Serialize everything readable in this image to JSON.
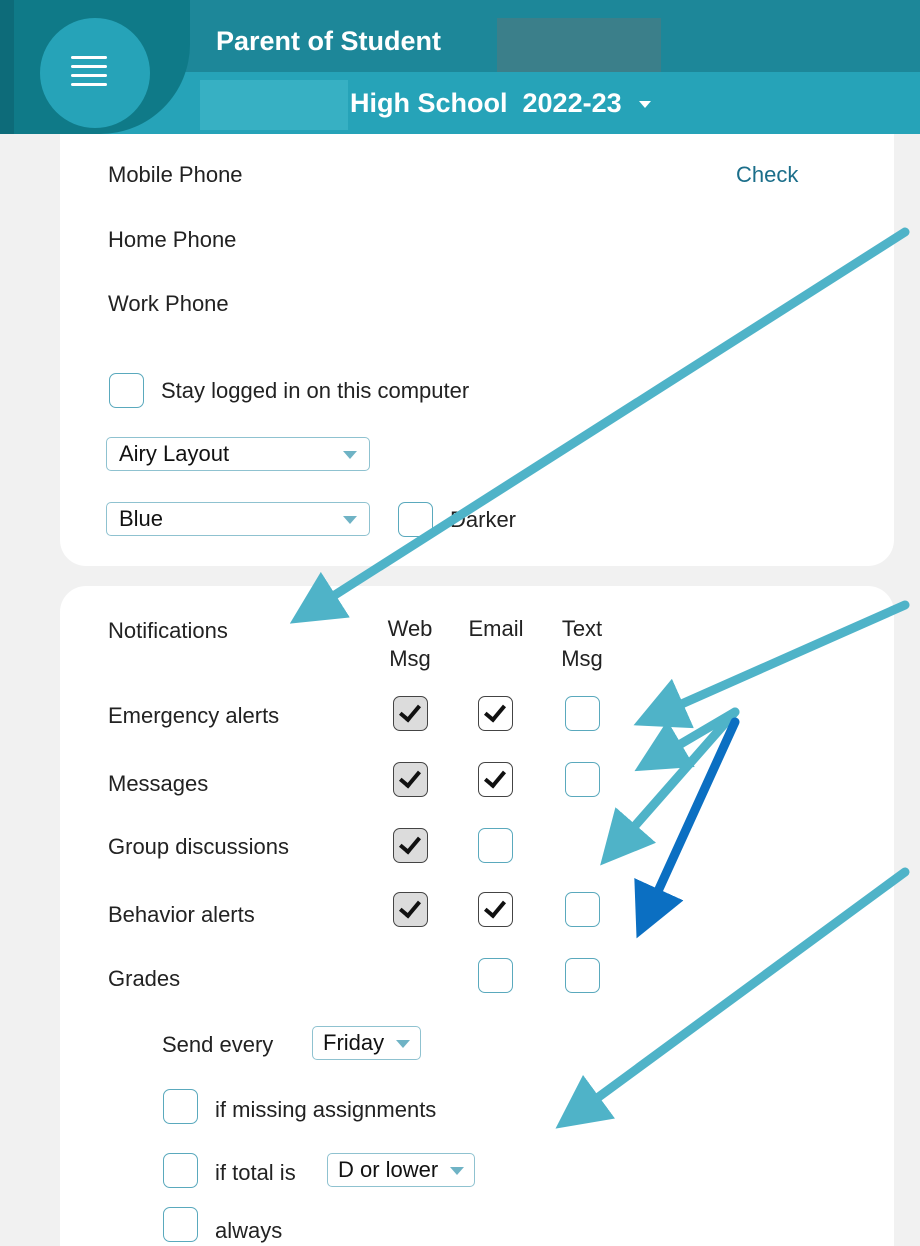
{
  "header": {
    "title": "Parent of Student",
    "school": "High School",
    "year": "2022-23"
  },
  "contact": {
    "mobile_label": "Mobile Phone",
    "check_label": "Check",
    "home_label": "Home Phone",
    "work_label": "Work Phone"
  },
  "settings": {
    "stay_logged_in_label": "Stay logged in on this computer",
    "stay_logged_in_checked": false,
    "layout_value": "Airy Layout",
    "color_value": "Blue",
    "darker_label": "Darker",
    "darker_checked": false
  },
  "notifications": {
    "title": "Notifications",
    "columns": [
      {
        "line1": "Web",
        "line2": "Msg"
      },
      {
        "line1": "Email",
        "line2": ""
      },
      {
        "line1": "Text",
        "line2": "Msg"
      }
    ],
    "rows": [
      {
        "label": "Emergency alerts",
        "web": true,
        "email": true,
        "text": false
      },
      {
        "label": "Messages",
        "web": true,
        "email": true,
        "text": false
      },
      {
        "label": "Group discussions",
        "web": true,
        "email": false,
        "text": null
      },
      {
        "label": "Behavior alerts",
        "web": true,
        "email": true,
        "text": false
      },
      {
        "label": "Grades",
        "web": null,
        "email": false,
        "text": false
      }
    ],
    "grades_options": {
      "send_every_label": "Send every",
      "send_every_value": "Friday",
      "missing_label": "if missing assignments",
      "total_label": "if total is",
      "total_value": "D or lower",
      "always_label": "always"
    }
  },
  "colors": {
    "header_dark": "#1d8799",
    "header_light": "#26a3b8",
    "annotation_light": "#4fb3c8",
    "annotation_dark": "#0b6fc2"
  },
  "icons": [
    "menu-icon",
    "caret-down-icon",
    "checkmark-icon",
    "annotation-arrow-icon"
  ]
}
